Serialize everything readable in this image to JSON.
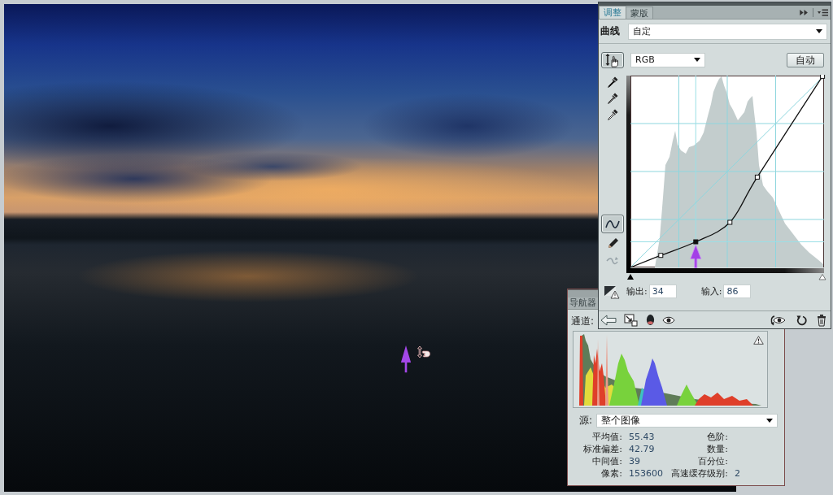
{
  "adjustments_panel": {
    "tabs": [
      {
        "label": "调整",
        "selected": true
      },
      {
        "label": "蒙版",
        "selected": false
      }
    ],
    "preset": {
      "label": "曲线",
      "value": "自定"
    },
    "channel": {
      "value": "RGB"
    },
    "auto_button": "自动",
    "tools": [
      {
        "kind": "hand",
        "selected": true,
        "disabled": false
      },
      {
        "kind": "blackpoint",
        "selected": false,
        "disabled": false
      },
      {
        "kind": "graypoint",
        "selected": false,
        "disabled": false
      },
      {
        "kind": "whitepoint",
        "selected": false,
        "disabled": false
      }
    ],
    "curve_tools": [
      {
        "kind": "curve",
        "selected": true,
        "disabled": false
      },
      {
        "kind": "pencil",
        "selected": false,
        "disabled": false
      },
      {
        "kind": "smooth",
        "selected": false,
        "disabled": true
      }
    ],
    "output": {
      "label": "输出:",
      "value": "34"
    },
    "input": {
      "label": "输入:",
      "value": "86"
    }
  },
  "histogram_panel": {
    "tabs": [
      {
        "label": "导航器",
        "selected": false
      }
    ],
    "channel_label": "通道:",
    "source": {
      "label": "源:",
      "value": "整个图像"
    },
    "stats": [
      {
        "label": "平均值:",
        "value": "55.43"
      },
      {
        "label": "标准偏差:",
        "value": "42.79"
      },
      {
        "label": "中间值:",
        "value": "39"
      },
      {
        "label": "像素:",
        "value": "153600"
      }
    ],
    "cache_stats": [
      {
        "label": "色阶:"
      },
      {
        "label": "数量:"
      },
      {
        "label": "百分位:"
      },
      {
        "label": "高速缓存级别:",
        "value": "2"
      }
    ]
  }
}
